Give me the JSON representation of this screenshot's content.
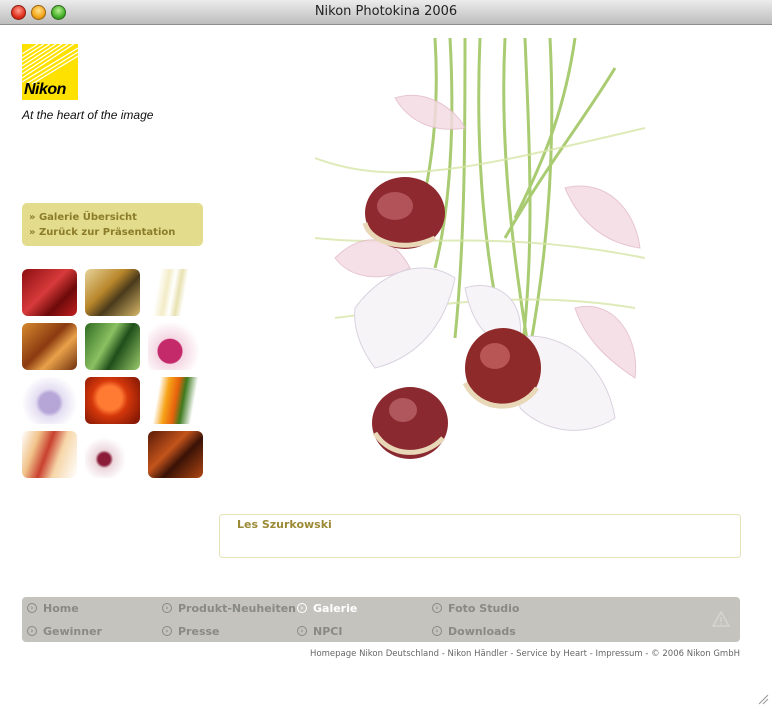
{
  "window": {
    "title": "Nikon Photokina 2006"
  },
  "brand": {
    "logo_text": "Nikon",
    "tagline": "At the heart of the image",
    "color": "#ffe100"
  },
  "side_menu": {
    "items": [
      {
        "label": "» Galerie Übersicht"
      },
      {
        "label": "» Zurück zur Präsentation"
      }
    ]
  },
  "gallery": {
    "thumbnails": [
      {
        "name": "red-abstract"
      },
      {
        "name": "dried-leaves"
      },
      {
        "name": "white-stems"
      },
      {
        "name": "brown-leaf"
      },
      {
        "name": "green-leaves"
      },
      {
        "name": "pink-flower"
      },
      {
        "name": "garlic"
      },
      {
        "name": "orange-glow"
      },
      {
        "name": "orange-tulip"
      },
      {
        "name": "red-stems"
      },
      {
        "name": "garlic-bulb"
      },
      {
        "name": "rust-texture"
      }
    ]
  },
  "caption": {
    "author": "Les Szurkowski"
  },
  "nav": {
    "items": [
      {
        "label": "Home",
        "active": false
      },
      {
        "label": "Produkt-Neuheiten",
        "active": false
      },
      {
        "label": "Galerie",
        "active": true
      },
      {
        "label": "Foto Studio",
        "active": false
      },
      {
        "label": "Gewinner",
        "active": false
      },
      {
        "label": "Presse",
        "active": false
      },
      {
        "label": "NPCI",
        "active": false
      },
      {
        "label": "Downloads",
        "active": false
      }
    ]
  },
  "footer": {
    "links_text": "Homepage Nikon Deutschland - Nikon Händler - Service by Heart -  Impressum - © 2006 Nikon GmbH"
  },
  "colors": {
    "menu_bg": "#e2dc8c",
    "menu_text": "#8c7c2a",
    "nav_bg": "#c4c3bd",
    "author_text": "#9b8a35"
  }
}
